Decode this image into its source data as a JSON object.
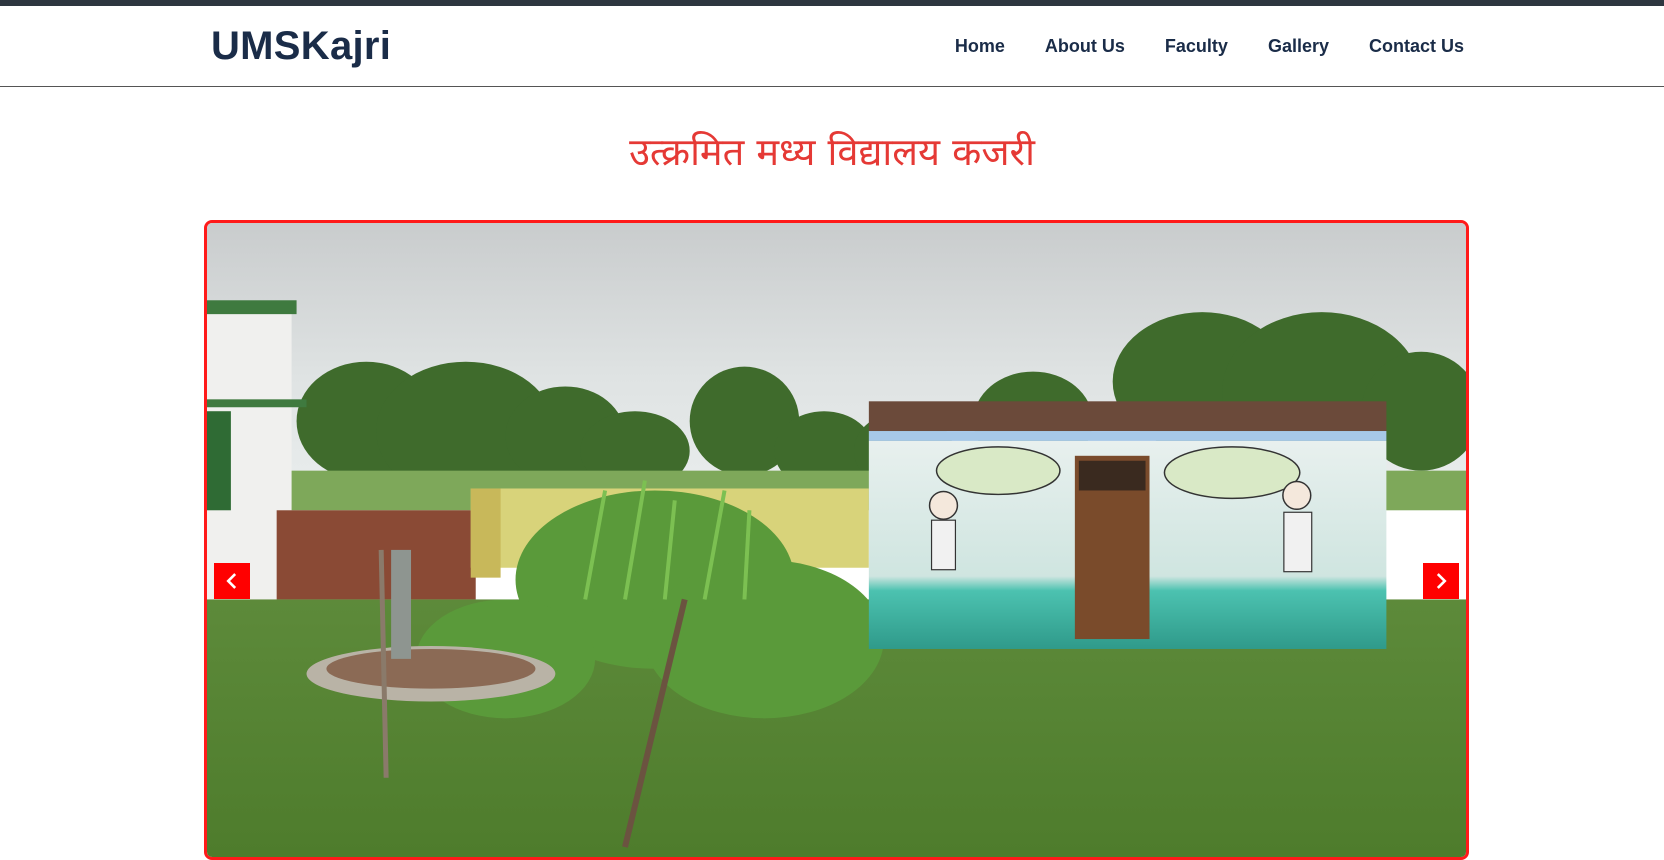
{
  "brand": "UMSKajri",
  "nav": {
    "items": [
      "Home",
      "About Us",
      "Faculty",
      "Gallery",
      "Contact Us"
    ]
  },
  "page_title": "उत्क्रमित मध्य विद्यालय कजरी",
  "slider": {
    "prev_icon": "chevron-left-icon",
    "next_icon": "chevron-right-icon",
    "image_description_only": true
  },
  "colors": {
    "accent": "#ff0000",
    "brand": "#1a2c48",
    "title": "#e53935",
    "topbar": "#2e3640"
  }
}
